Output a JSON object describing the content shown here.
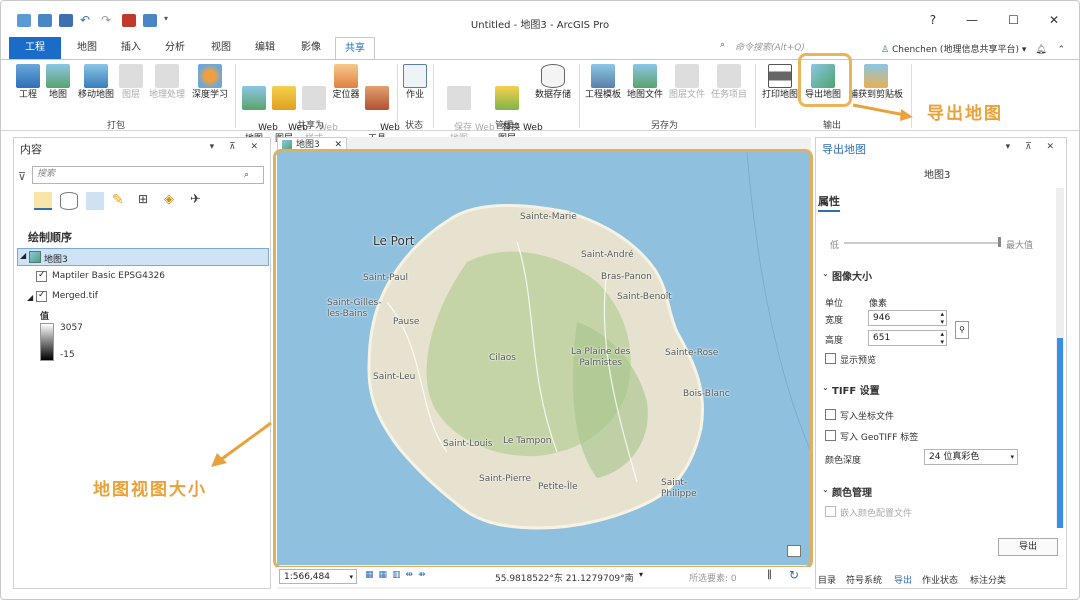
{
  "window": {
    "title": "Untitled - 地图3 - ArcGIS Pro",
    "help": "?",
    "minimize": "—",
    "maximize": "☐",
    "close": "✕"
  },
  "tabs": [
    {
      "label": "工程"
    },
    {
      "label": "地图"
    },
    {
      "label": "插入"
    },
    {
      "label": "分析"
    },
    {
      "label": "视图"
    },
    {
      "label": "编辑"
    },
    {
      "label": "影像"
    },
    {
      "label": "共享"
    }
  ],
  "command_search": {
    "placeholder": "命令搜索(Alt+Q)"
  },
  "user": {
    "name": "Chenchen (地理信息共享平台) ▾"
  },
  "ribbon": {
    "buttons": [
      {
        "label": "工程"
      },
      {
        "label": "地图"
      },
      {
        "label": "移动地图"
      },
      {
        "label": "图层"
      },
      {
        "label": "地理处理"
      },
      {
        "label": "深度学习"
      },
      {
        "label": "Web\n地图"
      },
      {
        "label": "Web\n图层"
      },
      {
        "label": "Web\n样式"
      },
      {
        "label": "定位器"
      },
      {
        "label": "Web\n工具"
      },
      {
        "label": "作业"
      },
      {
        "label": "保存 Web\n地图"
      },
      {
        "label": "替换 Web\n图层"
      },
      {
        "label": "数据存储"
      },
      {
        "label": "工程模板"
      },
      {
        "label": "地图文件"
      },
      {
        "label": "图层文件"
      },
      {
        "label": "任务项目"
      },
      {
        "label": "打印地图"
      },
      {
        "label": "导出地图"
      },
      {
        "label": "捕获到剪贴板"
      }
    ],
    "groups": [
      "打包",
      "共享为",
      "状态",
      "管理",
      "另存为",
      "输出"
    ]
  },
  "contents": {
    "title": "内容",
    "search_placeholder": "搜索",
    "draw_order": "绘制顺序",
    "map_name": "地图3",
    "layers": [
      {
        "name": "Maptiler Basic EPSG4326",
        "checked": true
      },
      {
        "name": "Merged.tif",
        "checked": true
      }
    ],
    "legend_label": "值",
    "legend_high": "3057",
    "legend_low": "-15"
  },
  "map": {
    "tab_label": "地图3",
    "places": [
      "Sainte-Marie",
      "Le Port",
      "Saint-André",
      "Saint-Paul",
      "Bras-Panon",
      "Saint-Benoît",
      "Saint-Gilles-\nles-Bains",
      "Pause",
      "Cilaos",
      "La Plaine des\nPalmistes",
      "Sainte-Rose",
      "Saint-Leu",
      "Bois-Blanc",
      "Saint-Louis",
      "Le Tampon",
      "Saint-Pierre",
      "Petite-Île",
      "Saint-\nPhilippe"
    ],
    "scale": "1:566,484",
    "coords": "55.9818522°东 21.1279709°南",
    "selected_features": "所选要素: 0"
  },
  "export": {
    "title": "导出地图",
    "map_name": "地图3",
    "properties": "属性",
    "quality_low": "低",
    "quality_high": "最大值",
    "image_size": "图像大小",
    "unit_label": "单位",
    "unit_value": "像素",
    "width_label": "宽度",
    "width_value": "946",
    "height_label": "高度",
    "height_value": "651",
    "show_preview": "显示预览",
    "tiff_settings": "TIFF 设置",
    "write_world_file": "写入坐标文件",
    "write_geotiff": "写入 GeoTIFF 标签",
    "color_depth_label": "颜色深度",
    "color_depth_value": "24 位真彩色",
    "color_mgmt": "颜色管理",
    "embed_profile": "嵌入颜色配置文件",
    "export_button": "导出",
    "bottom_tabs": [
      "目录",
      "符号系统",
      "导出",
      "作业状态",
      "标注分类"
    ]
  },
  "annotations": {
    "export_map": "导出地图",
    "map_view_size": "地图视图大小"
  },
  "colors": {
    "accent": "#1a6cc8",
    "highlight": "#e9b45a",
    "sea": "#8fc1de"
  }
}
